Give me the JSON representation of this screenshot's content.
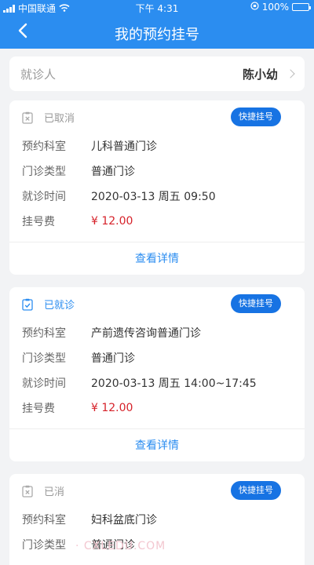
{
  "statusbar": {
    "carrier": "中国联通",
    "time": "下午 4:31",
    "battery": "100%",
    "battery_fraction": 1.0
  },
  "nav": {
    "title": "我的预约挂号",
    "back_icon": "chevron-left-icon"
  },
  "patient": {
    "label": "就诊人",
    "name": "陈小幼"
  },
  "appointments": [
    {
      "status": "已取消",
      "quick_label": "快捷挂号",
      "dept_label": "预约科室",
      "dept": "儿科普通门诊",
      "type_label": "门诊类型",
      "type": "普通门诊",
      "time_label": "就诊时间",
      "time": "2020-03-13 周五 09:50",
      "fee_label": "挂号费",
      "fee": "¥ 12.00",
      "detail_label": "查看详情"
    },
    {
      "status": "已就诊",
      "quick_label": "快捷挂号",
      "dept_label": "预约科室",
      "dept": "产前遗传咨询普通门诊",
      "type_label": "门诊类型",
      "type": "普通门诊",
      "time_label": "就诊时间",
      "time": "2020-03-13 周五 14:00~17:45",
      "fee_label": "挂号费",
      "fee": "¥ 12.00",
      "detail_label": "查看详情"
    },
    {
      "status": "已消",
      "quick_label": "快捷挂号",
      "dept_label": "预约科室",
      "dept": "妇科盆底门诊",
      "type_label": "门诊类型",
      "type": "普通门诊"
    }
  ],
  "watermark": "· CXLEDU.COM",
  "colors": {
    "primary": "#2b8df0",
    "button": "#1773e3",
    "fee": "#d6222a",
    "muted": "#999999"
  }
}
